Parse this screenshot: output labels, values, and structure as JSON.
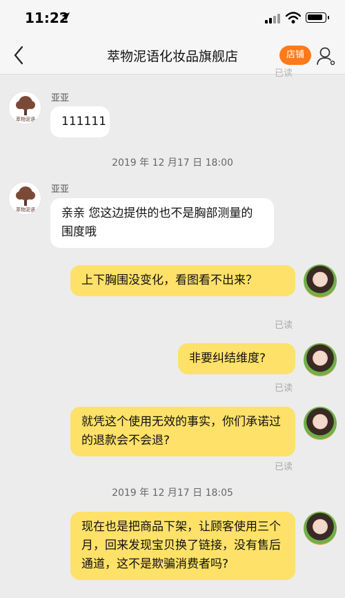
{
  "status_bar": {
    "time": "11:22"
  },
  "nav": {
    "title": "萃物泥语化妆品旗舰店",
    "shop_button": "店铺"
  },
  "top_partial_read": "已读",
  "store_avatar_text": "萃物泥语",
  "messages": [
    {
      "sender": "亚亚",
      "text": "111111"
    },
    {
      "timestamp": "2019 年 12 月17 日 18:00"
    },
    {
      "sender": "亚亚",
      "text": "亲亲  您这边提供的也不是胸部测量的围度哦"
    },
    {
      "text": "上下胸围没变化，看图看不出来？",
      "status": "已读"
    },
    {
      "text": "非要纠结维度?",
      "status": "已读"
    },
    {
      "text": "就凭这个使用无效的事实，你们承诺过的退款会不会退?",
      "status": "已读"
    },
    {
      "timestamp": "2019 年 12 月17 日 18:05"
    },
    {
      "text": "现在也是把商品下架，让顾客使用三个月，回来发现宝贝换了链接，没有售后通道，这不是欺骗消费者吗?"
    }
  ],
  "icons": {
    "back": "chevron-left-icon",
    "location": "location-arrow-icon",
    "signal": "cellular-signal-icon",
    "wifi": "wifi-icon",
    "battery": "battery-icon",
    "profile": "user-profile-icon"
  },
  "colors": {
    "accent_orange": "#ff7a1a",
    "outgoing_bubble": "#fde168",
    "incoming_bubble": "#ffffff",
    "background": "#ececec"
  }
}
